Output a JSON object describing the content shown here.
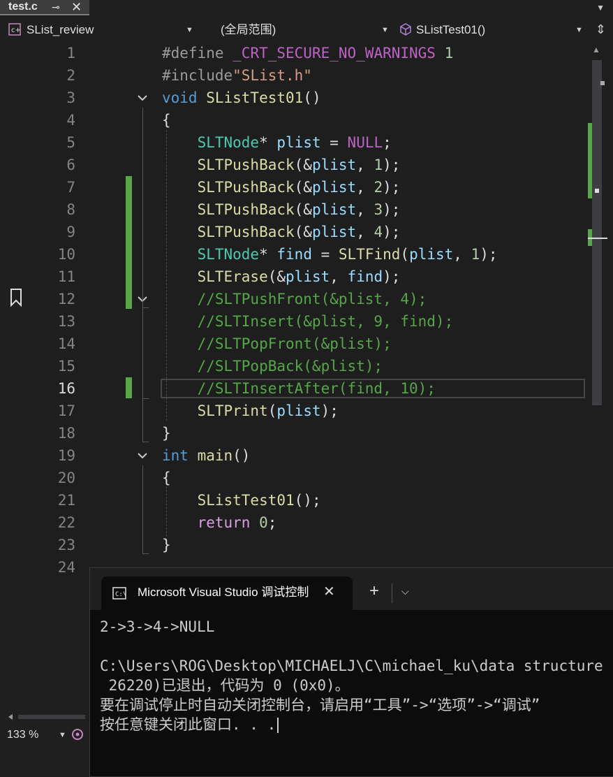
{
  "tab": {
    "name": "test.c",
    "pin_icon": "pin-icon",
    "close_label": "✕"
  },
  "nav": {
    "project": "SList_review",
    "scope": "(全局范围)",
    "function": "SListTest01()"
  },
  "line_numbers": [
    "1",
    "2",
    "3",
    "4",
    "5",
    "6",
    "7",
    "8",
    "9",
    "10",
    "11",
    "12",
    "13",
    "14",
    "15",
    "16",
    "17",
    "18",
    "19",
    "20",
    "21",
    "22",
    "23",
    "24"
  ],
  "current_line": "16",
  "code": {
    "l1a": "#define ",
    "l1b": "_CRT_SECURE_NO_WARNINGS",
    "l1c": " 1",
    "l2a": "#include",
    "l2b": "\"SList.h\"",
    "l3a": "void ",
    "l3b": "SListTest01",
    "l3c": "()",
    "l4": "{",
    "l5a": "    ",
    "l5b": "SLTNode",
    "l5c": "* ",
    "l5d": "plist",
    "l5e": " = ",
    "l5f": "NULL",
    "l5g": ";",
    "l6a": "    ",
    "l6b": "SLTPushBack",
    "l6c": "(&",
    "l6d": "plist",
    "l6e": ", ",
    "l6f": "1",
    "l6g": ");",
    "l7f": "2",
    "l8f": "3",
    "l9f": "4",
    "l10b": "SLTNode",
    "l10c": "* ",
    "l10d": "find",
    "l10e": " = ",
    "l10f": "SLTFind",
    "l10g": "(",
    "l10h": "plist",
    "l10i": ", ",
    "l10j": "1",
    "l10k": ");",
    "l11b": "SLTErase",
    "l11c": "(&",
    "l11d": "plist",
    "l11e": ", ",
    "l11f": "find",
    "l11g": ");",
    "l12": "    //SLTPushFront(&plist, 4);",
    "l13": "    //SLTInsert(&plist, 9, find);",
    "l14": "    //SLTPopFront(&plist);",
    "l15": "    //SLTPopBack(&plist);",
    "l16": "    //SLTInsertAfter(find, 10);",
    "l17b": "SLTPrint",
    "l17c": "(",
    "l17d": "plist",
    "l17e": ");",
    "l18": "}",
    "l19a": "int ",
    "l19b": "main",
    "l19c": "()",
    "l20": "{",
    "l21b": "SListTest01",
    "l21c": "();",
    "l22b": "return ",
    "l22c": "0",
    "l22d": ";",
    "l23": "}"
  },
  "status": {
    "zoom": "133 %"
  },
  "console": {
    "title": "Microsoft Visual Studio 调试控制台",
    "close_label": "✕",
    "plus_label": "+",
    "lines": [
      "2->3->4->NULL",
      "",
      "C:\\Users\\ROG\\Desktop\\MICHAELJ\\C\\michael_ku\\data structure",
      " 26220)已退出，代码为 0 (0x0)。",
      "要在调试停止时自动关闭控制台，请启用“工具”->“选项”->“调试”",
      "按任意键关闭此窗口. . ."
    ]
  },
  "colors": {
    "change_bar": "#57a64a",
    "background": "#1e1e1e",
    "keyword": "#569cd6",
    "comment": "#57a64a"
  }
}
